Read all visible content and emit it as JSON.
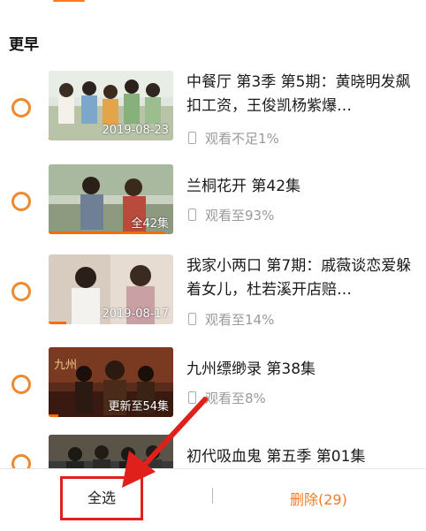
{
  "section": {
    "title": "更早"
  },
  "items": [
    {
      "title": "中餐厅 第3季 第5期：黄晓明发飙扣工资，王俊凯杨紫爆…",
      "thumb_label": "2019-08-23",
      "progress": "观看不足1%",
      "progress_fraction": 0.01
    },
    {
      "title": "兰桐花开 第42集",
      "thumb_label": "全42集",
      "progress": "观看至93%",
      "progress_fraction": 0.93
    },
    {
      "title": "我家小两口 第7期：戚薇谈恋爱躲着女儿，杜若溪开店赔…",
      "thumb_label": "2019-08-17",
      "progress": "观看至14%",
      "progress_fraction": 0.14
    },
    {
      "title": "九州缥缈录 第38集",
      "thumb_label": "更新至54集",
      "progress": "观看至8%",
      "progress_fraction": 0.08
    },
    {
      "title": "初代吸血鬼 第五季 第01集",
      "thumb_label": "",
      "progress": "",
      "progress_fraction": 0
    }
  ],
  "bottom": {
    "select_all": "全选",
    "delete": "删除(29)"
  },
  "colors": {
    "accent": "#f07a2a",
    "highlight": "#e0201b"
  }
}
